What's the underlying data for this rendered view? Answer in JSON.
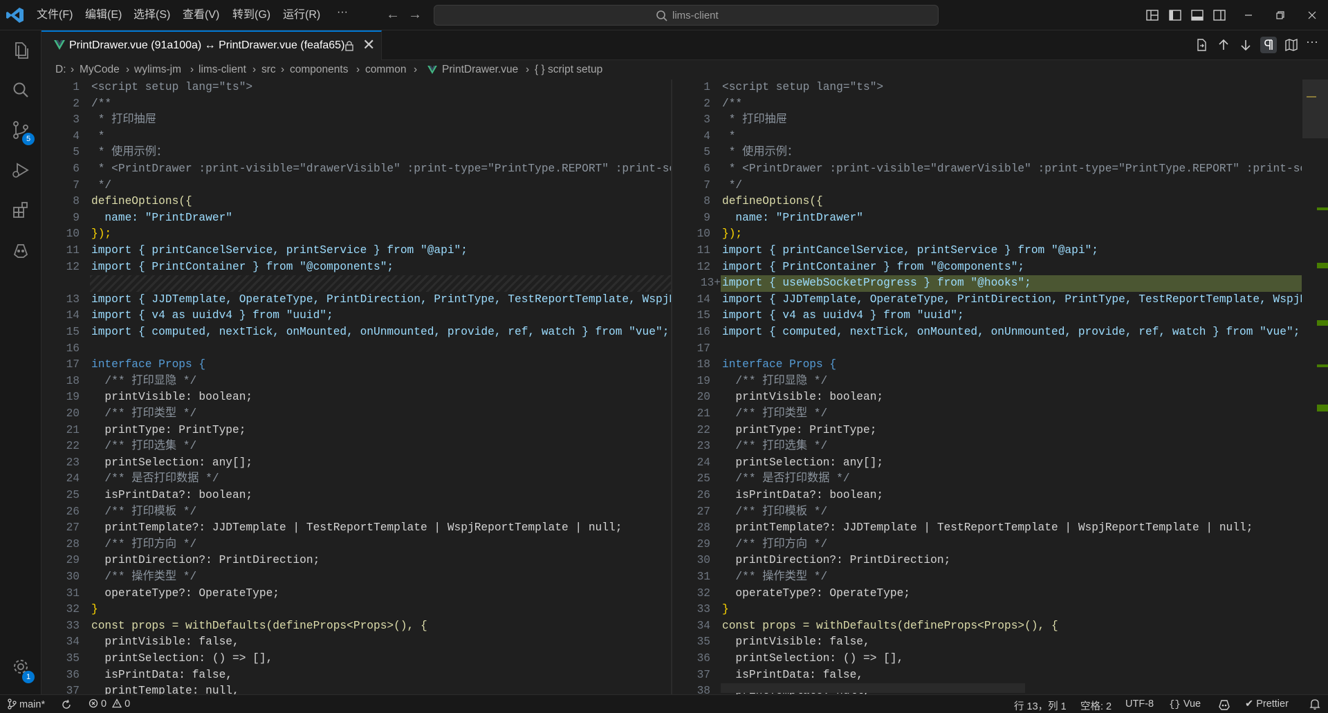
{
  "menu": [
    "文件(F)",
    "编辑(E)",
    "选择(S)",
    "查看(V)",
    "转到(G)",
    "运行(R)",
    "···"
  ],
  "search": {
    "text": "lims-client"
  },
  "activity": {
    "source_control_badge": "5",
    "accounts_badge": "1"
  },
  "tab": {
    "title": "PrintDrawer.vue (91a100a) ↔ PrintDrawer.vue (feafa65)",
    "close": "✕"
  },
  "breadcrumb": [
    "D:",
    "MyCode",
    "wylims-jm",
    "lims-client",
    "src",
    "components",
    "common",
    "PrintDrawer.vue",
    "{ } script setup"
  ],
  "left_numbers": [
    "1",
    "2",
    "3",
    "4",
    "5",
    "6",
    "7",
    "8",
    "9",
    "10",
    "11",
    "12",
    "",
    "13",
    "14",
    "15",
    "16",
    "17",
    "18",
    "19",
    "20",
    "21",
    "22",
    "23",
    "24",
    "25",
    "26",
    "27",
    "28",
    "29",
    "30",
    "31",
    "32",
    "33",
    "34",
    "35",
    "36",
    "37"
  ],
  "right_numbers": [
    "1",
    "2",
    "3",
    "4",
    "5",
    "6",
    "7",
    "8",
    "9",
    "10",
    "11",
    "12",
    "13+",
    "14",
    "15",
    "16",
    "17",
    "18",
    "19",
    "20",
    "21",
    "22",
    "23",
    "24",
    "25",
    "26",
    "27",
    "28",
    "29",
    "30",
    "31",
    "32",
    "33",
    "34",
    "35",
    "36",
    "37",
    "38"
  ],
  "lines": [
    "<script setup lang=\"ts\">",
    "/**",
    " * 打印抽屉",
    " *",
    " * 使用示例：",
    " * <PrintDrawer :print-visible=\"drawerVisible\" :print-type=\"PrintType.REPORT\" :print-sel",
    " */",
    "defineOptions({",
    "  name: \"PrintDrawer\"",
    "});",
    "import { printCancelService, printService } from \"@api\";",
    "import { PrintContainer } from \"@components\";",
    "import { useWebSocketProgress } from \"@hooks\";",
    "import { JJDTemplate, OperateType, PrintDirection, PrintType, TestReportTemplate, WspjRe",
    "import { v4 as uuidv4 } from \"uuid\";",
    "import { computed, nextTick, onMounted, onUnmounted, provide, ref, watch } from \"vue\";",
    "",
    "interface Props {",
    "  /** 打印显隐 */",
    "  printVisible: boolean;",
    "  /** 打印类型 */",
    "  printType: PrintType;",
    "  /** 打印选集 */",
    "  printSelection: any[];",
    "  /** 是否打印数据 */",
    "  isPrintData?: boolean;",
    "  /** 打印模板 */",
    "  printTemplate?: JJDTemplate | TestReportTemplate | WspjReportTemplate | null;",
    "  /** 打印方向 */",
    "  printDirection?: PrintDirection;",
    "  /** 操作类型 */",
    "  operateType?: OperateType;",
    "}",
    "const props = withDefaults(defineProps<Props>(), {",
    "  printVisible: false,",
    "  printSelection: () => [],",
    "  isPrintData: false,",
    "  printTemplate: null,"
  ],
  "status": {
    "branch": "main*",
    "errors": "0",
    "warnings": "0",
    "position": "行 13，列 1",
    "spaces": "空格: 2",
    "encoding": "UTF-8",
    "language": "Vue",
    "formatter": "Prettier"
  },
  "colors": {
    "accent": "#0078d4",
    "added_line": "#4b5632",
    "vue_green": "#42b883"
  }
}
